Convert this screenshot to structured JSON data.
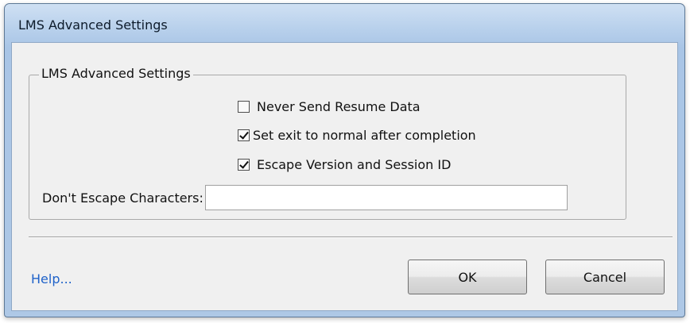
{
  "window": {
    "title": "LMS Advanced Settings"
  },
  "group": {
    "title": "LMS Advanced Settings",
    "checkboxes": [
      {
        "label": "Never Send Resume Data",
        "checked": false
      },
      {
        "label": "Set exit to normal after completion",
        "checked": true
      },
      {
        "label": "Escape Version and Session ID",
        "checked": true
      }
    ],
    "dont_escape_label": "Don't Escape Characters:",
    "dont_escape_value": ""
  },
  "footer": {
    "help_link": "Help...",
    "ok_label": "OK",
    "cancel_label": "Cancel"
  },
  "colors": {
    "title_bar": "#b9d1ec",
    "dialog_bg": "#f0f0f0",
    "link": "#1f62c9"
  }
}
